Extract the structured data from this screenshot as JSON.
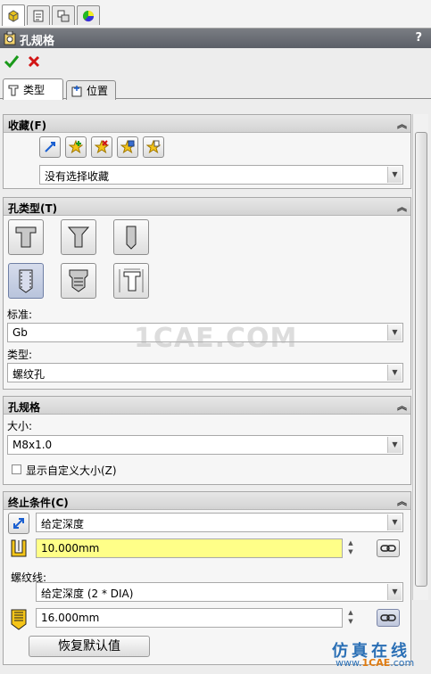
{
  "title": "孔规格",
  "help": "?",
  "subtabs": [
    "类型",
    "位置"
  ],
  "favorites": {
    "header": "收藏(F)",
    "selected": "没有选择收藏"
  },
  "hole_type": {
    "header": "孔类型(T)",
    "standard_label": "标准:",
    "standard_value": "Gb",
    "type_label": "类型:",
    "type_value": "螺纹孔"
  },
  "hole_spec": {
    "header": "孔规格",
    "size_label": "大小:",
    "size_value": "M8x1.0",
    "custom_size_label": "显示自定义大小(Z)"
  },
  "end_condition": {
    "header": "终止条件(C)",
    "condition_value": "给定深度",
    "depth_value": "10.000mm",
    "thread_label": "螺纹线:",
    "thread_value": "给定深度 (2 * DIA)",
    "thread_depth_value": "16.000mm",
    "reset_label": "恢复默认值"
  },
  "watermark": "1CAE.COM",
  "site_text": "仿真在线",
  "site_url_prefix": "www.",
  "site_url_brand": "1CAE",
  "site_url_suffix": ".com",
  "colors": {
    "title_bar": "#5c6068",
    "highlight_field": "#ffff88",
    "ok": "#1a9a1a",
    "cancel": "#d21515"
  }
}
